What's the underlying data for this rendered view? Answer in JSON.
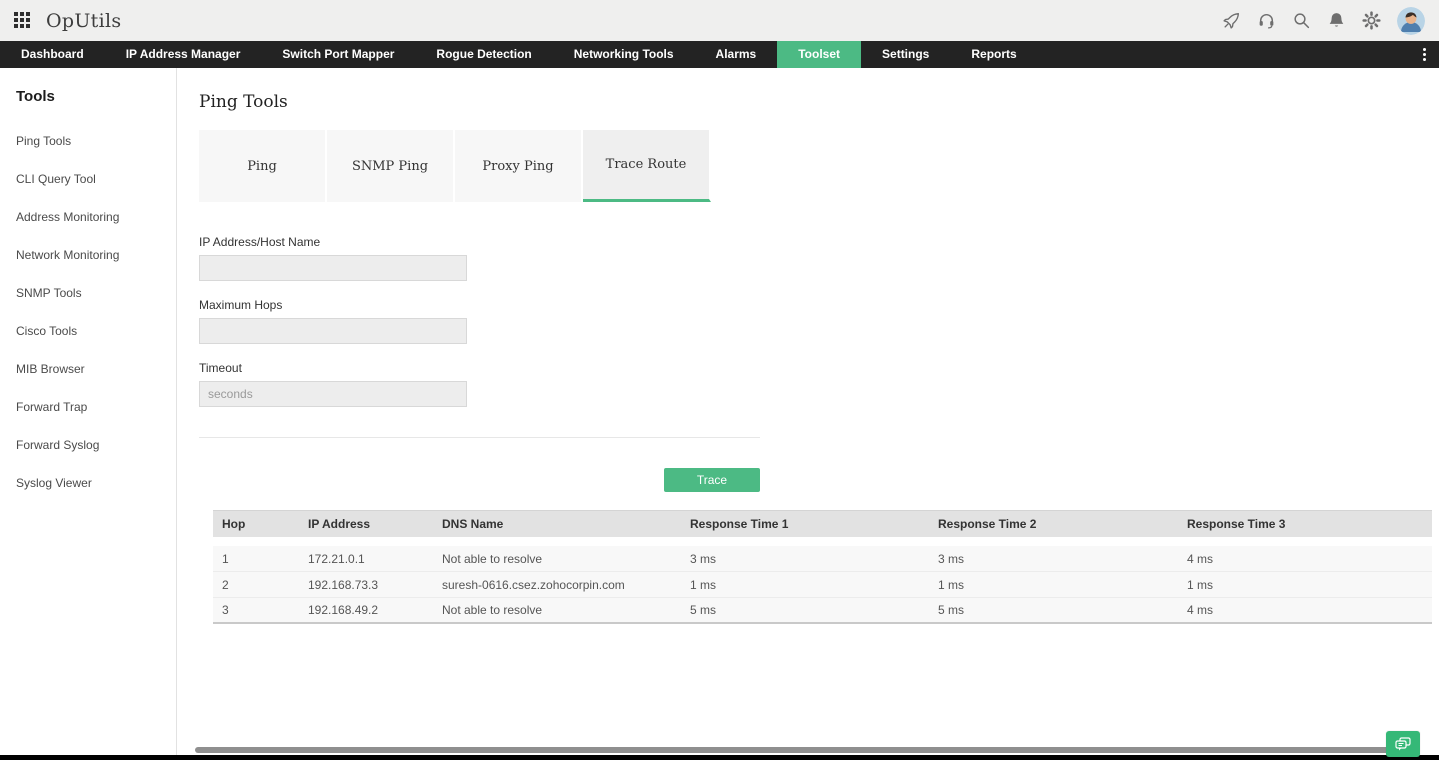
{
  "topbar": {
    "app_title": "OpUtils",
    "menu_icon": "apps-grid-icon",
    "action_icons": [
      "rocket-icon",
      "headset-icon",
      "search-icon",
      "bell-icon",
      "gear-icon"
    ],
    "avatar": "user-avatar"
  },
  "nav": {
    "items": [
      "Dashboard",
      "IP Address Manager",
      "Switch Port Mapper",
      "Rogue Detection",
      "Networking Tools",
      "Alarms",
      "Toolset",
      "Settings",
      "Reports"
    ],
    "active_item": "Toolset",
    "overflow_menu_icon": "kebab-menu-icon"
  },
  "sidebar": {
    "title": "Tools",
    "items": [
      "Ping Tools",
      "CLI Query Tool",
      "Address Monitoring",
      "Network Monitoring",
      "SNMP Tools",
      "Cisco Tools",
      "MIB Browser",
      "Forward Trap",
      "Forward Syslog",
      "Syslog Viewer"
    ]
  },
  "main": {
    "title": "Ping Tools",
    "tabs": [
      "Ping",
      "SNMP Ping",
      "Proxy Ping",
      "Trace Route"
    ],
    "active_tab": "Trace Route",
    "form": {
      "fields": [
        {
          "label": "IP Address/Host Name",
          "value": "",
          "placeholder": ""
        },
        {
          "label": "Maximum Hops",
          "value": "",
          "placeholder": ""
        },
        {
          "label": "Timeout",
          "value": "",
          "placeholder": "seconds"
        }
      ],
      "trace_button": "Trace"
    },
    "table": {
      "columns": [
        "Hop",
        "IP Address",
        "DNS Name",
        "Response Time 1",
        "Response Time 2",
        "Response Time 3"
      ],
      "rows": [
        [
          "1",
          "172.21.0.1",
          "Not able to resolve",
          "3 ms",
          "3 ms",
          "4 ms"
        ],
        [
          "2",
          "192.168.73.3",
          "suresh-0616.csez.zohocorpin.com",
          "1 ms",
          "1 ms",
          "1 ms"
        ],
        [
          "3",
          "192.168.49.2",
          "Not able to resolve",
          "5 ms",
          "5 ms",
          "4 ms"
        ]
      ]
    }
  },
  "footer": {
    "chat_icon": "chat-bubbles-icon"
  },
  "appearance": {
    "accent_green": "#4cba84",
    "chat_button_green": "#35b877",
    "navbar_bg": "#232323",
    "topbar_bg": "#efefee",
    "table_header_bg": "#e2e2e2"
  }
}
